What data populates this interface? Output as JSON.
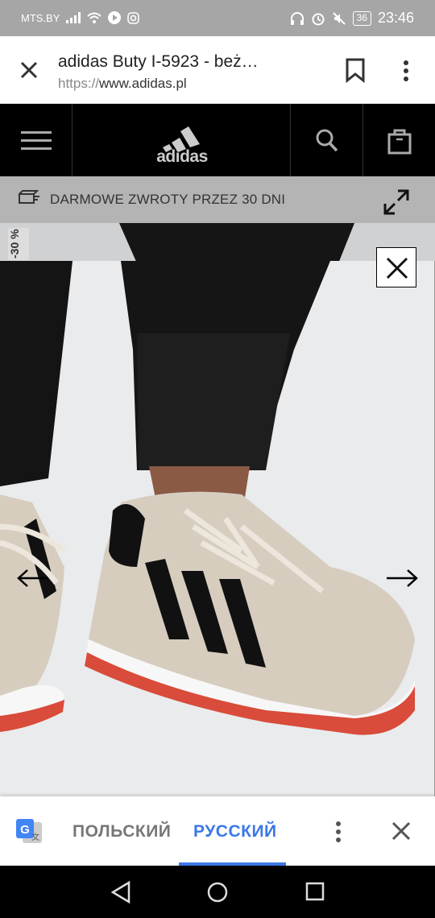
{
  "status_bar": {
    "carrier": "MTS.BY",
    "battery": "36",
    "time": "23:46"
  },
  "browser_tab": {
    "title": "adidas Buty I-5923 - beż…",
    "url_scheme": "https://",
    "url_host": "www.adidas.pl"
  },
  "site_header": {
    "logo_text": "adidas"
  },
  "promo": {
    "text": "DARMOWE ZWROTY PRZEZ 30 DNI"
  },
  "product": {
    "side_tag": "-30 %"
  },
  "translate_bar": {
    "source_language": "ПОЛЬСКИЙ",
    "target_language": "РУССКИЙ"
  },
  "colors": {
    "accent": "#3b78e7",
    "header_bg": "#000000",
    "promo_bg": "#b4b4b4",
    "sole_red": "#d94b3a"
  }
}
